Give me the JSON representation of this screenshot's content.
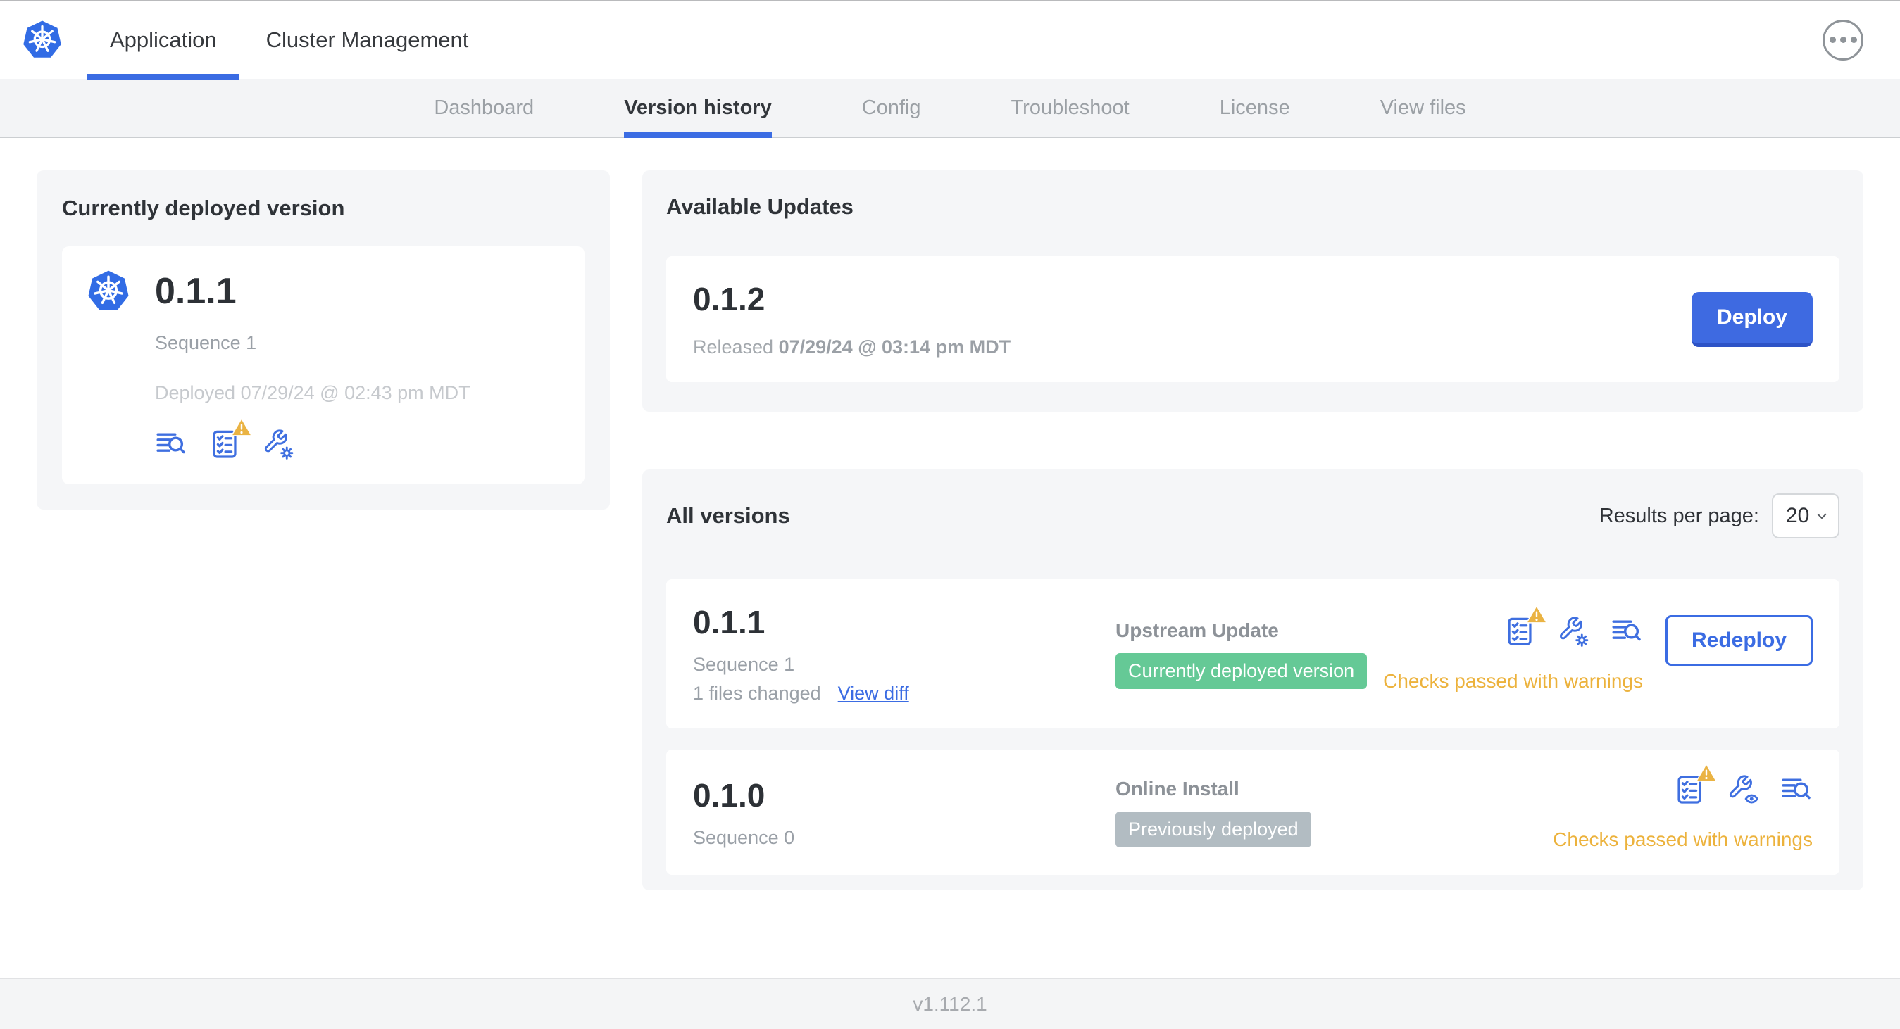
{
  "top_nav": {
    "tabs": [
      {
        "label": "Application"
      },
      {
        "label": "Cluster Management"
      }
    ]
  },
  "sub_nav": {
    "tabs": [
      "Dashboard",
      "Version history",
      "Config",
      "Troubleshoot",
      "License",
      "View files"
    ],
    "active": "Version history"
  },
  "current": {
    "title": "Currently deployed version",
    "version": "0.1.1",
    "sequence": "Sequence 1",
    "deployed": "Deployed 07/29/24 @ 02:43 pm MDT"
  },
  "available_updates": {
    "title": "Available Updates",
    "version": "0.1.2",
    "released_label": "Released",
    "released_date": "07/29/24 @ 03:14 pm MDT",
    "deploy_button": "Deploy"
  },
  "all_versions": {
    "title": "All versions",
    "results_per_page_label": "Results per page:",
    "results_per_page": "20",
    "rows": [
      {
        "version": "0.1.1",
        "sequence": "Sequence 1",
        "files_changed": "1 files changed",
        "view_diff": "View diff",
        "source": "Upstream Update",
        "badge": "Currently deployed version",
        "status": "Checks passed with warnings",
        "action": "Redeploy"
      },
      {
        "version": "0.1.0",
        "sequence": "Sequence 0",
        "source": "Online Install",
        "badge": "Previously deployed",
        "status": "Checks passed with warnings"
      }
    ]
  },
  "footer": {
    "app_version": "v1.112.1"
  },
  "colors": {
    "accent_blue": "#3b6ce3",
    "kubernetes_blue": "#326ce5",
    "deploy_button_blue": "#3e6ae1",
    "success_green": "#65c996",
    "warning_orange": "#ecb23c",
    "badge_gray": "#b2bcc2"
  }
}
